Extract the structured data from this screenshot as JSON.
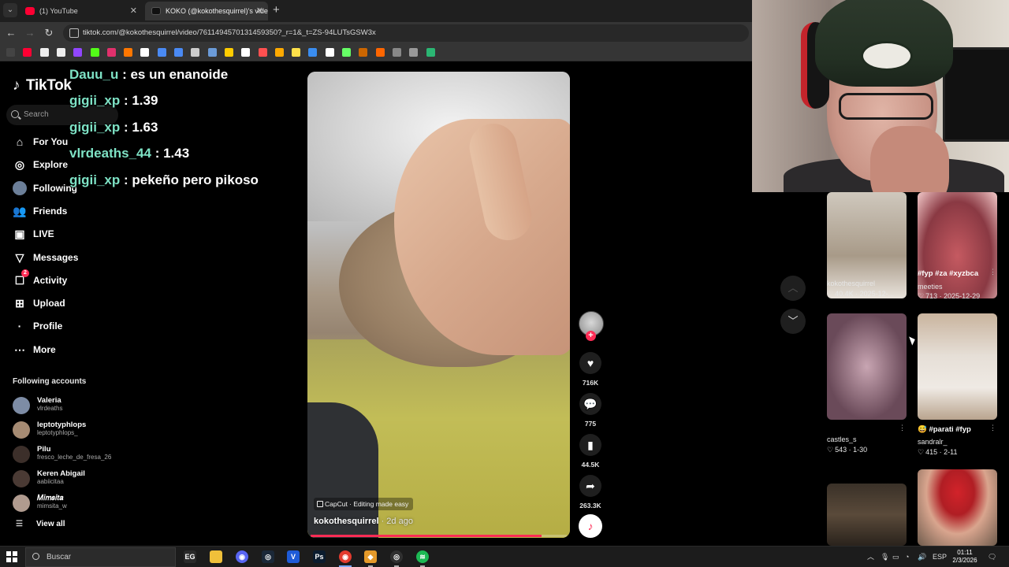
{
  "browser": {
    "tabs": [
      {
        "label": "(1) YouTube",
        "icon": "youtube-icon",
        "color": "#ff0033"
      },
      {
        "label": "KOKO (@kokothesquirrel)'s video",
        "icon": "tiktok-icon",
        "color": "#ffffff"
      }
    ],
    "url": "tiktok.com/@kokothesquirrel/video/7611494570131459350?_r=1&_t=ZS-94LUTsGSW3x",
    "bookmark_icons": [
      "google-icon",
      "youtube-icon",
      "notion-icon",
      "github-icon",
      "twitch-icon",
      "kick-icon",
      "instagram-icon",
      "soundcloud-icon",
      "x-icon",
      "translate-icon",
      "bookmark-icon",
      "stack-icon",
      "bookmark-icon",
      "folder-icon",
      "notion-icon",
      "bookmark-icon",
      "bookmark-icon",
      "bookmark-icon",
      "bookmark-icon",
      "bookmark-icon",
      "bookmark-icon",
      "bookmark-icon",
      "bookmark-icon",
      "bookmark-icon",
      "bookmark-icon",
      "sheets-icon"
    ]
  },
  "tiktok": {
    "logo": "TikTok",
    "search_placeholder": "Search",
    "nav": [
      {
        "label": "For You",
        "icon": "home-icon",
        "name": "for-you"
      },
      {
        "label": "Explore",
        "icon": "compass-icon",
        "name": "explore"
      },
      {
        "label": "Following",
        "icon": "following-icon",
        "name": "following"
      },
      {
        "label": "Friends",
        "icon": "friends-icon",
        "name": "friends"
      },
      {
        "label": "LIVE",
        "icon": "live-icon",
        "name": "live"
      },
      {
        "label": "Messages",
        "icon": "messages-icon",
        "name": "messages"
      },
      {
        "label": "Activity",
        "icon": "activity-icon",
        "name": "activity",
        "badge": "2"
      },
      {
        "label": "Upload",
        "icon": "upload-icon",
        "name": "upload"
      },
      {
        "label": "Profile",
        "icon": "profile-icon",
        "name": "profile"
      },
      {
        "label": "More",
        "icon": "more-icon",
        "name": "more"
      }
    ],
    "following_accounts_title": "Following accounts",
    "following_accounts": [
      {
        "name": "Valeria",
        "handle": "vlrdeaths"
      },
      {
        "name": "leptotyphlops",
        "handle": "leptotyphlops_"
      },
      {
        "name": "Pilu",
        "handle": "fresco_leche_de_fresa_26"
      },
      {
        "name": "Keren Abigail",
        "handle": "aabiicitaa"
      },
      {
        "name": "𝑀𝑖𝑚𝑠𝑖𝑡𝑎",
        "handle": "mimsita_w"
      }
    ],
    "view_all": "View all"
  },
  "chat": [
    {
      "user": "Dauu_u",
      "message": ": es un enanoide",
      "color": "#7ee2c5"
    },
    {
      "user": "gigii_xp",
      "message": ": 1.39",
      "color": "#7ee2c5"
    },
    {
      "user": "gigii_xp",
      "message": ": 1.63",
      "color": "#7ee2c5"
    },
    {
      "user": "vlrdeaths_44",
      "message": ": 1.43",
      "color": "#7ee2c5"
    },
    {
      "user": "gigii_xp",
      "message": ": pekeño pero pikoso",
      "color": "#7ee2c5"
    }
  ],
  "video": {
    "capcut_label": "CapCut · Editing made easy",
    "author": "kokothesquirrel",
    "posted": " · 2d ago",
    "progress": 0.9
  },
  "actions": {
    "likes": "716K",
    "comments": "775",
    "saves": "44.5K",
    "shares": "263.3K"
  },
  "related": [
    {
      "title": "",
      "user": "kokothesquirrel",
      "likes": "40.4K",
      "date": "2025-12-..."
    },
    {
      "title": "#fyp #za #xyzbca",
      "user": "meeties",
      "likes": "713",
      "date": "2025-12-29"
    },
    {
      "title": "",
      "user": "castles_s",
      "likes": "543",
      "date": "1-30"
    },
    {
      "title": "😅 #parati #fyp",
      "user": "sandralr_",
      "likes": "415",
      "date": "2-11"
    },
    {
      "title": "",
      "user": "",
      "likes": "",
      "date": ""
    },
    {
      "title": "",
      "user": "",
      "likes": "",
      "date": ""
    }
  ],
  "taskbar": {
    "search_placeholder": "Buscar",
    "apps": [
      "epic-games-icon",
      "file-explorer-icon",
      "discord-icon",
      "steam-icon",
      "vegas-icon",
      "photoshop-icon",
      "chrome-icon",
      "app-icon",
      "obs-icon",
      "spotify-icon"
    ],
    "language": "ESP",
    "time": "01:11",
    "date": "2/3/2026"
  }
}
